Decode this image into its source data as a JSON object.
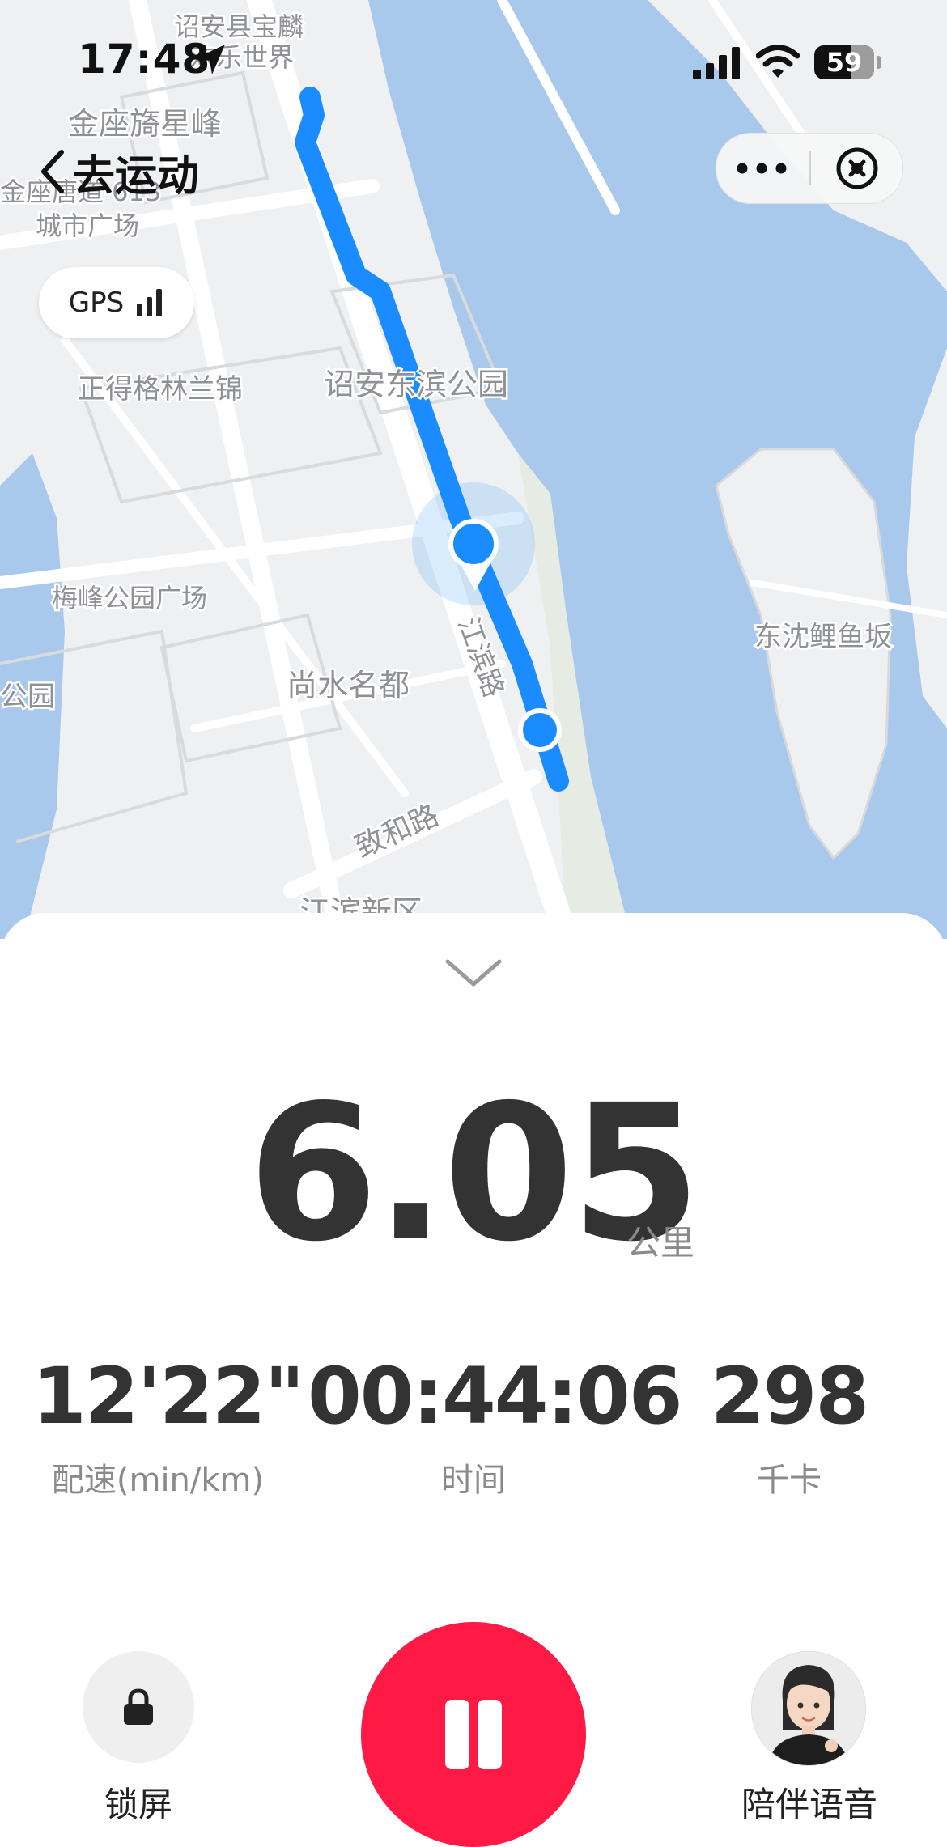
{
  "status_bar": {
    "time": "17:48",
    "battery": "59"
  },
  "nav": {
    "title": "去运动"
  },
  "map": {
    "gps_label": "GPS",
    "labels": [
      "诏安县宝麟",
      "欢乐世界",
      "金座旖星峰",
      "金座唐道·613",
      "城市广场",
      "正得格林兰锦",
      "诏安东滨公园",
      "梅峰公园广场",
      "东沈鲤鱼坂",
      "尚水名都",
      "江滨路",
      "致和路",
      "公园",
      "江滨新区"
    ]
  },
  "distance": {
    "value": "6.05",
    "unit": "公里"
  },
  "stats": [
    {
      "value": "12'22\"",
      "label": "配速(min/km)"
    },
    {
      "value": "00:44:06",
      "label": "时间"
    },
    {
      "value": "298",
      "label": "千卡"
    }
  ],
  "controls": {
    "lock_label": "锁屏",
    "voice_label": "陪伴语音"
  },
  "colors": {
    "route": "#1a8cff",
    "pause_button": "#ff1a45",
    "water": "#a8c8ec",
    "land": "#eff0f2"
  },
  "icons": [
    "location-arrow-icon",
    "signal-icon",
    "wifi-icon",
    "battery-icon",
    "back-chevron-icon",
    "more-icon",
    "close-icon",
    "gps-signal-icon",
    "collapse-chevron-icon",
    "lock-icon",
    "pause-icon",
    "companion-avatar"
  ]
}
